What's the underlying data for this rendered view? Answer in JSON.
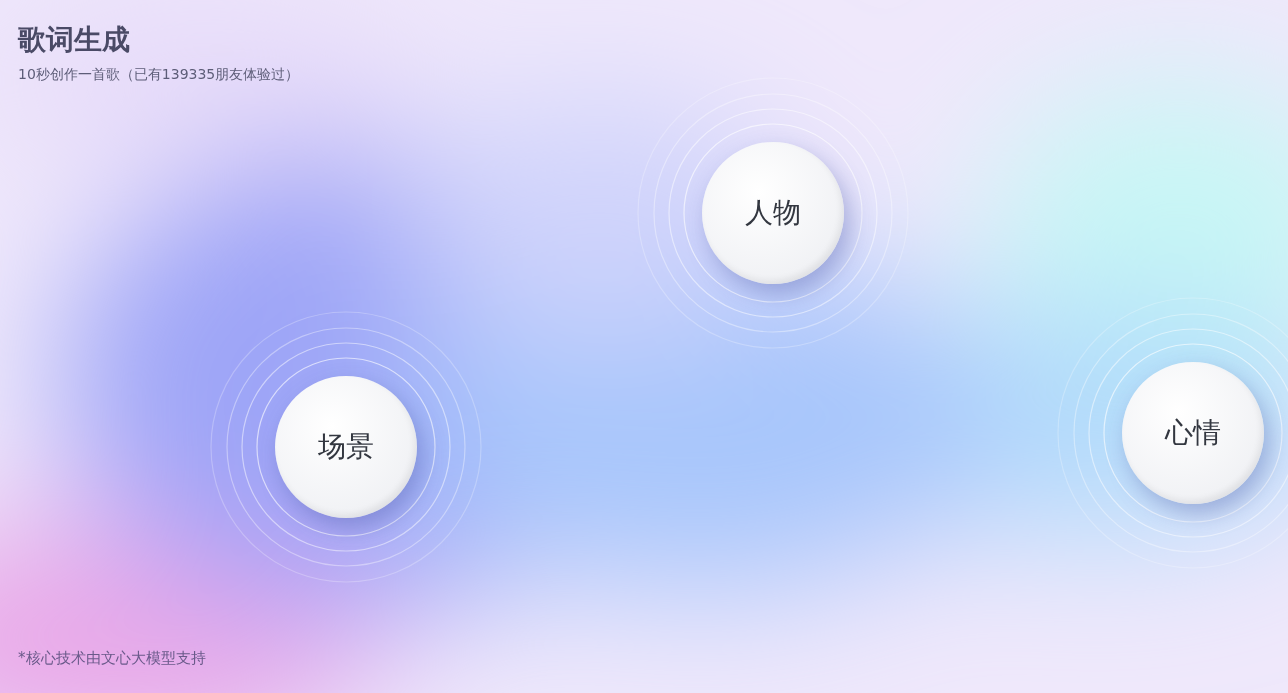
{
  "header": {
    "title": "歌词生成",
    "subtitle": "10秒创作一首歌（已有139335朋友体验过）"
  },
  "bubbles": [
    {
      "label": "人物"
    },
    {
      "label": "场景"
    },
    {
      "label": "心情"
    }
  ],
  "footer": {
    "note": "*核心技术由文心大模型支持"
  }
}
